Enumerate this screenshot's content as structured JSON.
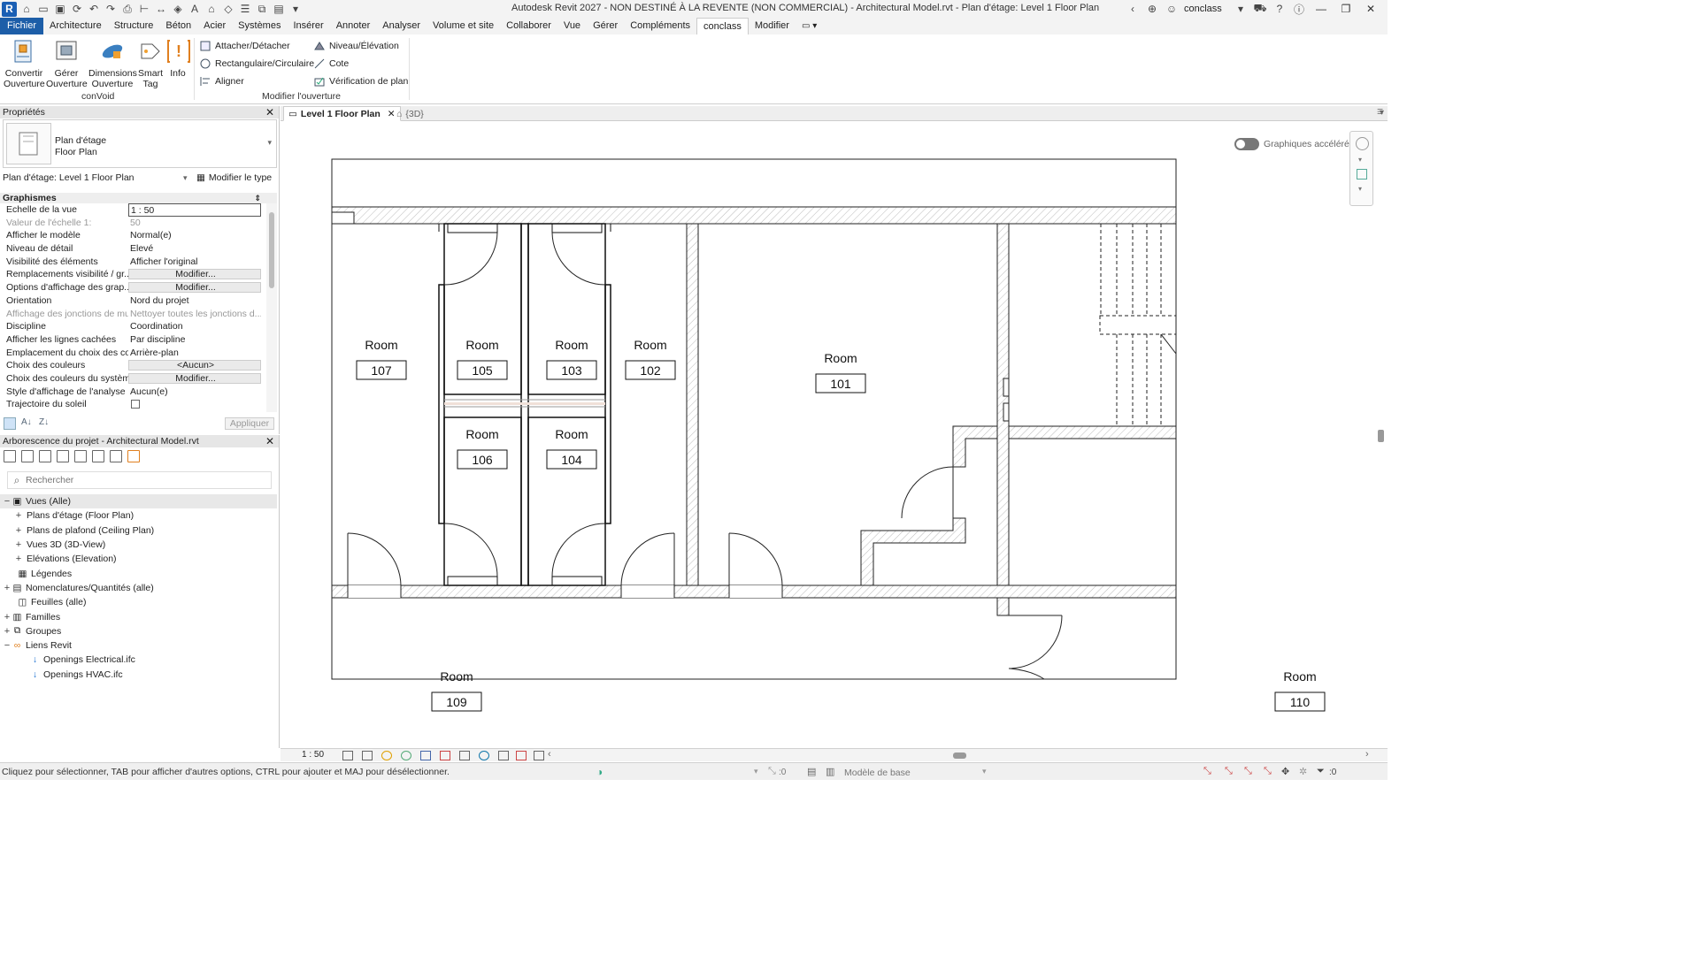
{
  "titlebar": {
    "title": "Autodesk Revit 2027 - NON DESTINÉ À LA REVENTE (NON COMMERCIAL) - Architectural Model.rvt - Plan d'étage: Level 1 Floor Plan",
    "user": "conclass"
  },
  "tabs": [
    "Fichier",
    "Architecture",
    "Structure",
    "Béton",
    "Acier",
    "Systèmes",
    "Insérer",
    "Annoter",
    "Analyser",
    "Volume et site",
    "Collaborer",
    "Vue",
    "Gérer",
    "Compléments",
    "conclass",
    "Modifier"
  ],
  "active_tab": "conclass",
  "ribbon": {
    "big_buttons": [
      {
        "label1": "Convertir",
        "label2": "Ouverture",
        "icon": "convert-opening-icon"
      },
      {
        "label1": "Gérer",
        "label2": "Ouverture",
        "icon": "manage-opening-icon"
      },
      {
        "label1": "Dimensions",
        "label2": "Ouverture",
        "icon": "dimension-opening-icon"
      },
      {
        "label1": "Smart",
        "label2": "Tag",
        "icon": "smart-tag-icon"
      },
      {
        "label1": "Info",
        "label2": "",
        "icon": "info-icon"
      }
    ],
    "panel1_label": "conVoid",
    "small_buttons": [
      {
        "label": "Attacher/Détacher",
        "icon": "attach-icon"
      },
      {
        "label": "Rectangulaire/Circulaire",
        "icon": "rect-circle-icon"
      },
      {
        "label": "Aligner",
        "icon": "align-icon"
      },
      {
        "label": "Niveau/Élévation",
        "icon": "level-icon"
      },
      {
        "label": "Cote",
        "icon": "dimension-icon"
      },
      {
        "label": "Vérification de plan",
        "icon": "plan-check-icon"
      }
    ],
    "panel2_label": "Modifier l'ouverture"
  },
  "properties": {
    "header": "Propriétés",
    "type_name_1": "Plan d'étage",
    "type_name_2": "Floor Plan",
    "instance": "Plan d'étage: Level 1 Floor Plan",
    "edit_type": "Modifier le type",
    "group": "Graphismes",
    "rows": [
      {
        "name": "Echelle de la vue",
        "value": "1 : 50"
      },
      {
        "name": "Valeur de l'échelle    1:",
        "value": "50"
      },
      {
        "name": "Afficher le modèle",
        "value": "Normal(e)"
      },
      {
        "name": "Niveau de détail",
        "value": "Elevé"
      },
      {
        "name": "Visibilité des éléments",
        "value": "Afficher l'original"
      },
      {
        "name": "Remplacements visibilité / gr...",
        "value": "Modifier..."
      },
      {
        "name": "Options d'affichage des grap...",
        "value": "Modifier..."
      },
      {
        "name": "Orientation",
        "value": "Nord du projet"
      },
      {
        "name": "Affichage des jonctions de mur",
        "value": "Nettoyer toutes les jonctions d..."
      },
      {
        "name": "Discipline",
        "value": "Coordination"
      },
      {
        "name": "Afficher les lignes cachées",
        "value": "Par discipline"
      },
      {
        "name": "Emplacement du choix des co...",
        "value": "Arrière-plan"
      },
      {
        "name": "Choix des couleurs",
        "value": "<Aucun>"
      },
      {
        "name": "Choix des couleurs du système",
        "value": "Modifier..."
      },
      {
        "name": "Style d'affichage de l'analyse ...",
        "value": "Aucun(e)"
      },
      {
        "name": "Trajectoire du soleil",
        "value": ""
      }
    ],
    "apply": "Appliquer"
  },
  "browser": {
    "header": "Arborescence du projet - Architectural Model.rvt",
    "search_placeholder": "Rechercher",
    "nodes": [
      {
        "label": "Vues (Alle)",
        "exp": "−"
      },
      {
        "label": "Plans d'étage (Floor Plan)",
        "exp": "+"
      },
      {
        "label": "Plans de plafond (Ceiling Plan)",
        "exp": "+"
      },
      {
        "label": "Vues 3D (3D-View)",
        "exp": "+"
      },
      {
        "label": "Elévations (Elevation)",
        "exp": "+"
      },
      {
        "label": "Légendes",
        "exp": ""
      },
      {
        "label": "Nomenclatures/Quantités (alle)",
        "exp": "+"
      },
      {
        "label": "Feuilles (alle)",
        "exp": ""
      },
      {
        "label": "Familles",
        "exp": "+"
      },
      {
        "label": "Groupes",
        "exp": "+"
      },
      {
        "label": "Liens Revit",
        "exp": "−"
      },
      {
        "label": "Openings Electrical.ifc",
        "exp": ""
      },
      {
        "label": "Openings HVAC.ifc",
        "exp": ""
      }
    ]
  },
  "viewtabs": {
    "active": "Level 1 Floor Plan",
    "other": "{3D}"
  },
  "canvas": {
    "accel_label": "Graphiques accélérés",
    "rooms": [
      {
        "name": "Room",
        "number": "107"
      },
      {
        "name": "Room",
        "number": "105"
      },
      {
        "name": "Room",
        "number": "103"
      },
      {
        "name": "Room",
        "number": "102"
      },
      {
        "name": "Room",
        "number": "101"
      },
      {
        "name": "Room",
        "number": "106"
      },
      {
        "name": "Room",
        "number": "104"
      },
      {
        "name": "Room",
        "number": "109"
      },
      {
        "name": "Room",
        "number": "110"
      }
    ]
  },
  "viewbar": {
    "scale": "1 : 50"
  },
  "status": {
    "text": "Cliquez pour sélectionner, TAB pour afficher d'autres options,  CTRL pour ajouter et MAJ pour désélectionner.",
    "selection": ":0",
    "model": "Modèle de base",
    "filter": ":0"
  }
}
